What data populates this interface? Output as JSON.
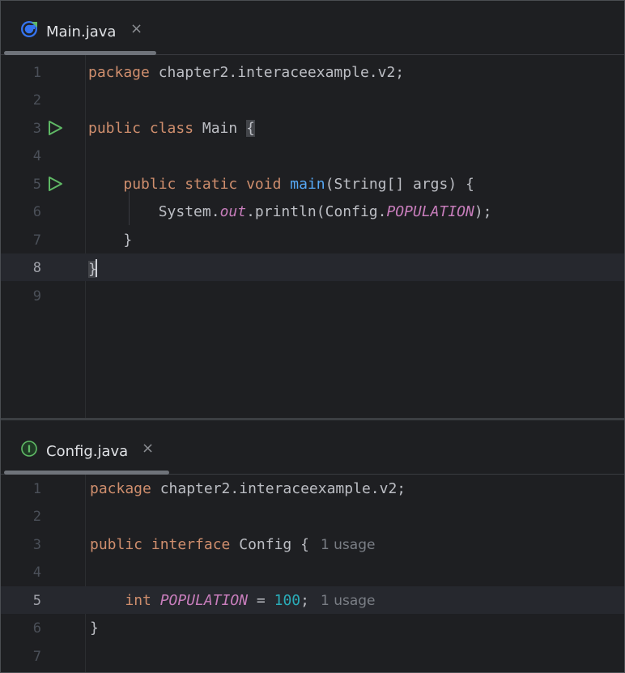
{
  "top_tab": {
    "label": "Main.java",
    "close": "×",
    "icon": "java-class-run-icon"
  },
  "bottom_tab": {
    "label": "Config.java",
    "close": "×",
    "icon": "interface-icon"
  },
  "main_lines": [
    {
      "num": "1",
      "text": "package chapter2.interaceexample.v2;"
    },
    {
      "num": "2",
      "text": ""
    },
    {
      "num": "3",
      "text": "public class Main {"
    },
    {
      "num": "4",
      "text": ""
    },
    {
      "num": "5",
      "text": "    public static void main(String[] args) {"
    },
    {
      "num": "6",
      "text": "        System.out.println(Config.POPULATION);"
    },
    {
      "num": "7",
      "text": "    }"
    },
    {
      "num": "8",
      "text": "}"
    },
    {
      "num": "9",
      "text": ""
    }
  ],
  "main_code": {
    "l1_kw": "package",
    "l1_rest": " chapter2.interaceexample.v2;",
    "l3_kw": "public class",
    "l3_name": " Main ",
    "l3_brace": "{",
    "l5_indent": "    ",
    "l5_kw": "public static void",
    "l5_fn": "main",
    "l5_rest": "(String[] args) {",
    "l6_indent": "        ",
    "l6_a": "System.",
    "l6_out": "out",
    "l6_b": ".println(Config.",
    "l6_pop": "POPULATION",
    "l6_c": ");",
    "l7": "    }",
    "l8": "}"
  },
  "config_lines": [
    {
      "num": "1"
    },
    {
      "num": "2"
    },
    {
      "num": "3"
    },
    {
      "num": "4"
    },
    {
      "num": "5"
    },
    {
      "num": "6"
    },
    {
      "num": "7"
    }
  ],
  "config_code": {
    "l1_kw": "package",
    "l1_rest": " chapter2.interaceexample.v2;",
    "l3_kw": "public interface",
    "l3_rest": " Config {",
    "l3_hint": "1 usage",
    "l5_indent": "    ",
    "l5_kw": "int",
    "l5_sp": " ",
    "l5_pop": "POPULATION",
    "l5_eq": " = ",
    "l5_num": "100",
    "l5_semi": ";",
    "l5_hint": "1 usage",
    "l6": "}"
  },
  "colors": {
    "background": "#1e1f22",
    "keyword": "#cf8e6d",
    "function": "#56a8f5",
    "static_field": "#c77dbb",
    "number": "#2aacb8",
    "run_icon": "#5fb865"
  }
}
